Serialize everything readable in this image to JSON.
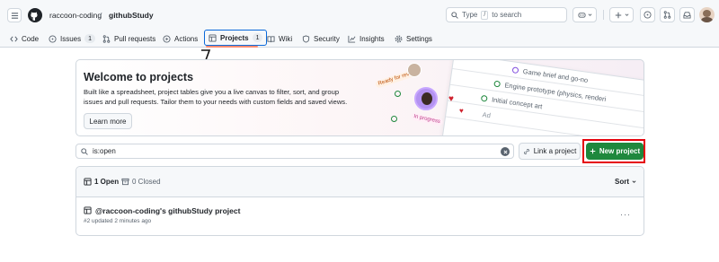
{
  "header": {
    "owner": "raccoon-coding",
    "separator": "/",
    "repo": "githubStudy",
    "search_placeholder_prefix": "Type",
    "search_key": "/",
    "search_placeholder_suffix": "to search"
  },
  "tabs": [
    {
      "label": "Code",
      "icon": "code-icon"
    },
    {
      "label": "Issues",
      "count": "1",
      "icon": "issue-icon"
    },
    {
      "label": "Pull requests",
      "icon": "pull-request-icon"
    },
    {
      "label": "Actions",
      "icon": "play-icon"
    },
    {
      "label": "Projects",
      "count": "1",
      "icon": "table-icon",
      "selected": true
    },
    {
      "label": "Wiki",
      "icon": "book-icon"
    },
    {
      "label": "Security",
      "icon": "shield-icon"
    },
    {
      "label": "Insights",
      "icon": "graph-icon"
    },
    {
      "label": "Settings",
      "icon": "gear-icon"
    }
  ],
  "annotation": "7.",
  "banner": {
    "title": "Welcome to projects",
    "description": "Built like a spreadsheet, project tables give you a live canvas to filter, sort, and group issues and pull requests. Tailor them to your needs with custom fields and saved views.",
    "learn_more": "Learn more",
    "illustration": {
      "ready_tag": "Ready for review",
      "progress_tag": "In progress",
      "row1": "Game brief and go-no",
      "row2": "Engine prototype (physics, renderi",
      "row3": "Initial concept art",
      "add_label": "Ad"
    }
  },
  "filter": {
    "value": "is:open",
    "link_project": "Link a project",
    "new_project": "New project"
  },
  "list": {
    "open_label": "1 Open",
    "closed_label": "0 Closed",
    "sort_label": "Sort",
    "items": [
      {
        "title": "@raccoon-coding's githubStudy project",
        "meta": "#2 updated 2 minutes ago"
      }
    ]
  },
  "colors": {
    "primary_green": "#1f883d",
    "highlight_red": "#e5000a",
    "selected_tab_border": "#0969da"
  }
}
